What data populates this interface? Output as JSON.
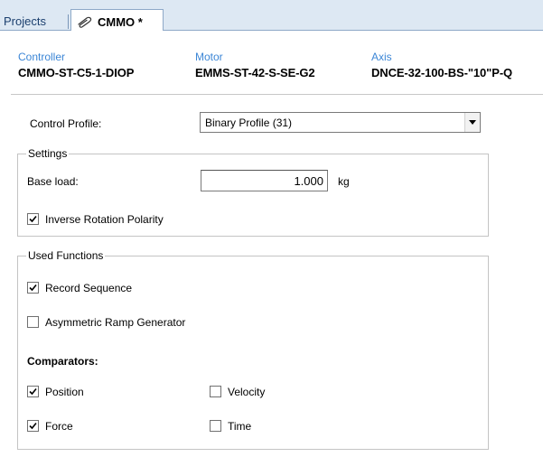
{
  "tabs": {
    "projects": "Projects",
    "active": "CMMO *"
  },
  "header": {
    "controller": {
      "caption": "Controller",
      "value": "CMMO-ST-C5-1-DIOP"
    },
    "motor": {
      "caption": "Motor",
      "value": "EMMS-ST-42-S-SE-G2"
    },
    "axis": {
      "caption": "Axis",
      "value": "DNCE-32-100-BS-\"10\"P-Q"
    }
  },
  "control_profile": {
    "label": "Control Profile:",
    "selected": "Binary Profile (31)"
  },
  "settings": {
    "title": "Settings",
    "base_load_label": "Base load:",
    "base_load_value": "1.000",
    "base_load_unit": "kg",
    "inverse_rotation": {
      "label": "Inverse Rotation Polarity",
      "checked": true
    }
  },
  "used_functions": {
    "title": "Used Functions",
    "record_sequence": {
      "label": "Record Sequence",
      "checked": true
    },
    "asymmetric_ramp": {
      "label": "Asymmetric Ramp Generator",
      "checked": false
    },
    "comparators_label": "Comparators:",
    "comparators": {
      "position": {
        "label": "Position",
        "checked": true
      },
      "velocity": {
        "label": "Velocity",
        "checked": false
      },
      "force": {
        "label": "Force",
        "checked": true
      },
      "time": {
        "label": "Time",
        "checked": false
      }
    }
  },
  "icons": {
    "tab_icon": "paperclip-icon",
    "dropdown_icon": "chevron-down-icon",
    "check_icon": "checkmark-icon"
  },
  "colors": {
    "tab_strip": "#dde8f3",
    "caption_blue": "#3c86d6",
    "group_border": "#c4c4c4"
  }
}
